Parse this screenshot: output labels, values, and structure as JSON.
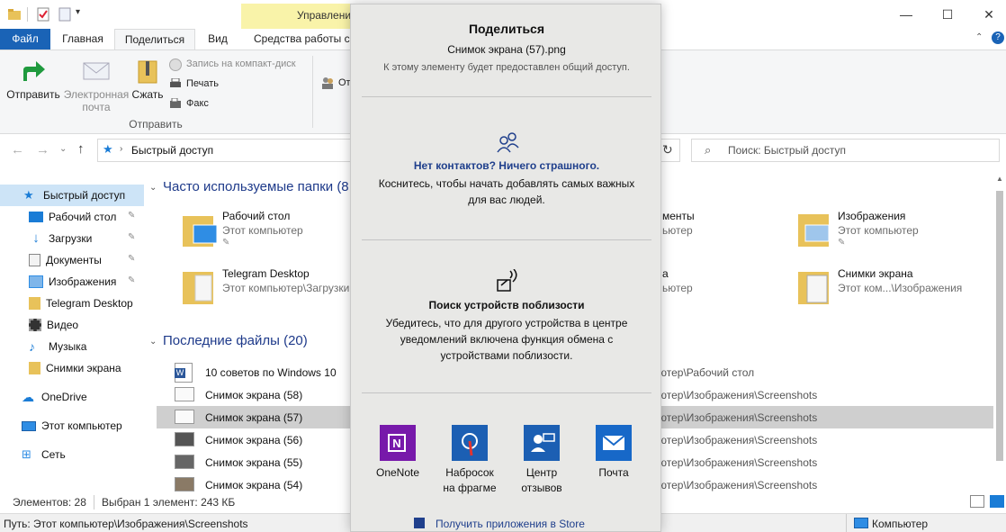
{
  "window": {
    "context_tab_group": "Управление",
    "controls": {
      "minimize": "—",
      "maximize": "☐",
      "close": "✕"
    }
  },
  "ribbon_tabs": {
    "file": "Файл",
    "home": "Главная",
    "share": "Поделиться",
    "view": "Вид",
    "tools": "Средства работы с р"
  },
  "ribbon": {
    "send": "Отправить",
    "email_line1": "Электронная",
    "email_line2": "почта",
    "zip": "Сжать",
    "burn": "Запись на компакт-диск",
    "print": "Печать",
    "fax": "Факс",
    "group_send": "Отправить",
    "share_with_partial": "От"
  },
  "address": {
    "path": "Быстрый доступ",
    "search_placeholder": "Поиск: Быстрый доступ"
  },
  "nav": [
    {
      "label": "Быстрый доступ",
      "icon": "star-icon",
      "color": "#1a7cd6"
    },
    {
      "label": "Рабочий стол",
      "icon": "desktop-icon",
      "color": "#1a7cd6"
    },
    {
      "label": "Загрузки",
      "icon": "download-icon",
      "color": "#1a7cd6"
    },
    {
      "label": "Документы",
      "icon": "document-icon",
      "color": "#7a7a7a"
    },
    {
      "label": "Изображения",
      "icon": "pictures-icon",
      "color": "#2f8de4"
    },
    {
      "label": "Telegram Desktop",
      "icon": "folder-icon",
      "color": "#e8c25a"
    },
    {
      "label": "Видео",
      "icon": "video-icon",
      "color": "#444"
    },
    {
      "label": "Музыка",
      "icon": "music-icon",
      "color": "#1a7cd6"
    },
    {
      "label": "Снимки экрана",
      "icon": "folder-icon",
      "color": "#e8c25a"
    },
    {
      "label": "OneDrive",
      "icon": "cloud-icon",
      "color": "#1a7cd6"
    },
    {
      "label": "Этот компьютер",
      "icon": "computer-icon",
      "color": "#2f8de4"
    },
    {
      "label": "Сеть",
      "icon": "network-icon",
      "color": "#2f8de4"
    }
  ],
  "frequent": {
    "header": "Часто используемые папки (8",
    "items": [
      {
        "title": "Рабочий стол",
        "sub": "Этот компьютер"
      },
      {
        "title": "Telegram Desktop",
        "sub": "Этот компьютер\\Загрузки"
      },
      {
        "title": "Изображения",
        "sub": "Этот компьютер"
      },
      {
        "title": "Снимки экрана",
        "sub": "Этот ком...\\Изображения"
      }
    ],
    "partial": [
      {
        "title": "менты",
        "sub": "ьютер"
      },
      {
        "title": "а",
        "sub": "ьютер"
      }
    ]
  },
  "recent": {
    "header": "Последние файлы (20)",
    "items": [
      {
        "name": "10 советов по Windows 10",
        "path": "ютер\\Рабочий стол"
      },
      {
        "name": "Снимок экрана (58)",
        "path": "ютер\\Изображения\\Screenshots"
      },
      {
        "name": "Снимок экрана (57)",
        "path": "ютер\\Изображения\\Screenshots"
      },
      {
        "name": "Снимок экрана (56)",
        "path": "ютер\\Изображения\\Screenshots"
      },
      {
        "name": "Снимок экрана (55)",
        "path": "ютер\\Изображения\\Screenshots"
      },
      {
        "name": "Снимок экрана (54)",
        "path": "ютер\\Изображения\\Screenshots"
      }
    ]
  },
  "status": {
    "items": "Элементов: 28",
    "selected": "Выбран 1 элемент: 243 КБ",
    "path": "Путь: Этот компьютер\\Изображения\\Screenshots",
    "computer": "Компьютер"
  },
  "share": {
    "title": "Поделиться",
    "filename": "Снимок экрана (57).png",
    "notice": "К этому элементу будет предоставлен общий доступ.",
    "contacts_title": "Нет контактов? Ничего страшного.",
    "contacts_body_1": "Коснитесь, чтобы начать добавлять самых важных",
    "contacts_body_2": "для вас людей.",
    "nearby_title": "Поиск устройств поблизости",
    "nearby_body_1": "Убедитесь, что для другого устройства в центре",
    "nearby_body_2": "уведомлений включена функция обмена с",
    "nearby_body_3": "устройствами поблизости.",
    "apps": [
      {
        "line1": "OneNote",
        "line2": "",
        "color": "#7719aa"
      },
      {
        "line1": "Набросок",
        "line2": "на фрагме",
        "color": "#1c5fb3"
      },
      {
        "line1": "Центр",
        "line2": "отзывов",
        "color": "#1c5fb3"
      },
      {
        "line1": "Почта",
        "line2": "",
        "color": "#1768c8"
      }
    ],
    "store_link": "Получить приложения в Store"
  }
}
